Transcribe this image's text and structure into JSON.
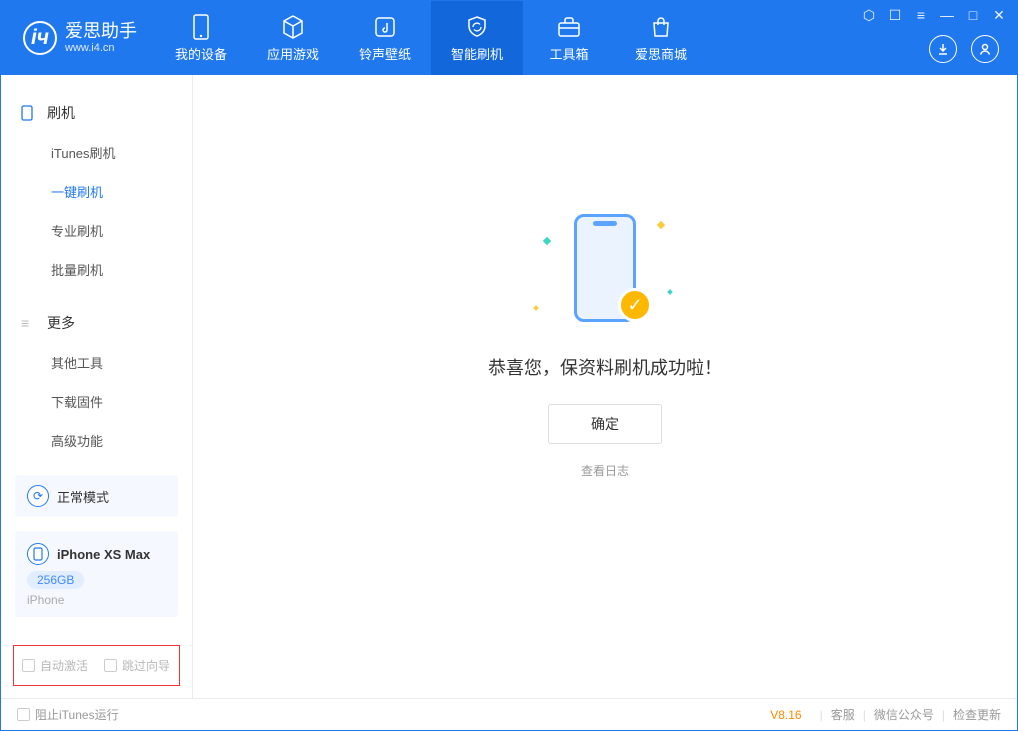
{
  "app": {
    "title": "爱思助手",
    "subtitle": "www.i4.cn"
  },
  "nav": {
    "items": [
      {
        "label": "我的设备"
      },
      {
        "label": "应用游戏"
      },
      {
        "label": "铃声壁纸"
      },
      {
        "label": "智能刷机"
      },
      {
        "label": "工具箱"
      },
      {
        "label": "爱思商城"
      }
    ],
    "active_index": 3
  },
  "sidebar": {
    "group1": {
      "title": "刷机"
    },
    "group1_items": [
      {
        "label": "iTunes刷机"
      },
      {
        "label": "一键刷机"
      },
      {
        "label": "专业刷机"
      },
      {
        "label": "批量刷机"
      }
    ],
    "group1_active_index": 1,
    "group2": {
      "title": "更多"
    },
    "group2_items": [
      {
        "label": "其他工具"
      },
      {
        "label": "下载固件"
      },
      {
        "label": "高级功能"
      }
    ],
    "mode_card": {
      "label": "正常模式"
    },
    "device": {
      "name": "iPhone XS Max",
      "storage": "256GB",
      "type": "iPhone"
    },
    "checkboxes": {
      "auto_activate": "自动激活",
      "skip_guide": "跳过向导"
    }
  },
  "main": {
    "success_text": "恭喜您，保资料刷机成功啦！",
    "ok_button": "确定",
    "view_log": "查看日志"
  },
  "footer": {
    "block_itunes": "阻止iTunes运行",
    "version": "V8.16",
    "links": {
      "support": "客服",
      "wechat": "微信公众号",
      "update": "检查更新"
    }
  }
}
